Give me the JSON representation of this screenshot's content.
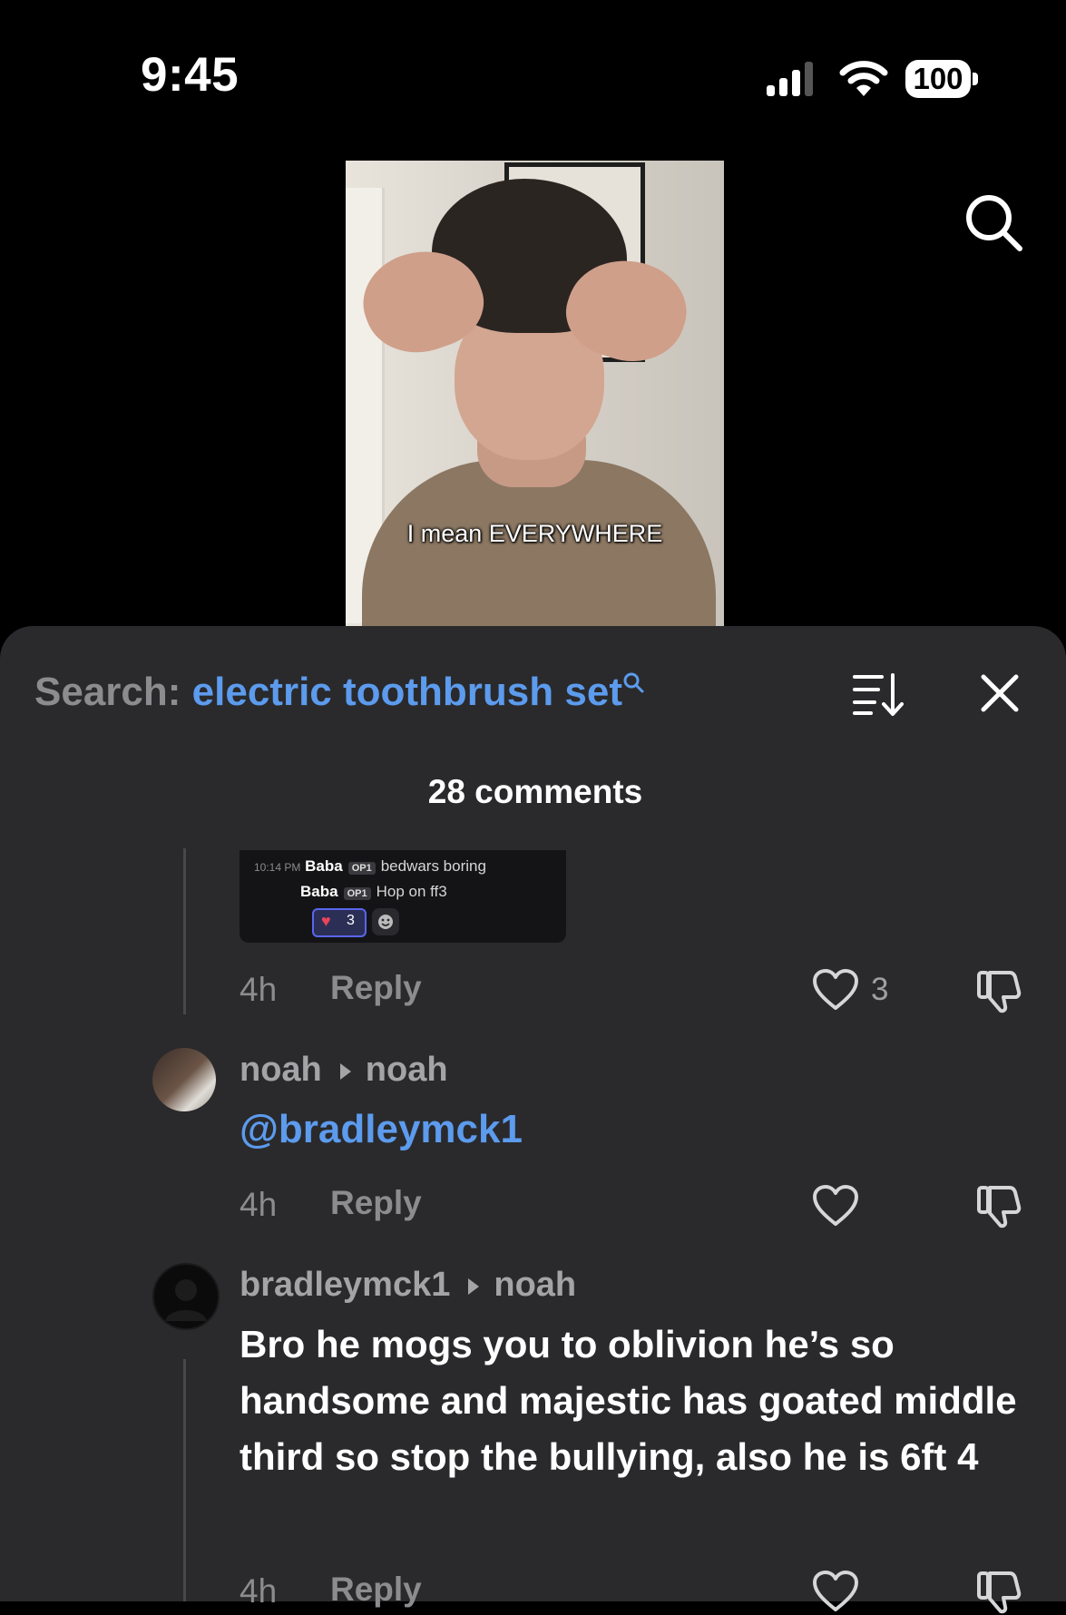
{
  "status_bar": {
    "time": "9:45",
    "battery": "100"
  },
  "video": {
    "caption": "I mean EVERYWHERE"
  },
  "comments_sheet": {
    "search_label": "Search:",
    "search_query": "electric toothbrush set",
    "count_text": "28 comments"
  },
  "embed": {
    "line1_time": "10:14 PM",
    "line1_name": "Baba",
    "line1_tag": "OP1",
    "line1_text": "bedwars boring",
    "line2_name": "Baba",
    "line2_tag": "OP1",
    "line2_text": "Hop on ff3",
    "reaction_count": "3"
  },
  "comments": [
    {
      "time": "4h",
      "reply": "Reply",
      "likes": "3"
    },
    {
      "author": "noah",
      "reply_to": "noah",
      "mention": "@bradleymck1",
      "time": "4h",
      "reply": "Reply"
    },
    {
      "author": "bradleymck1",
      "reply_to": "noah",
      "text": "Bro he mogs you to oblivion he’s so handsome and majestic has goated middle third so stop the bullying, also he is 6ft 4",
      "time": "4h",
      "reply": "Reply"
    }
  ]
}
